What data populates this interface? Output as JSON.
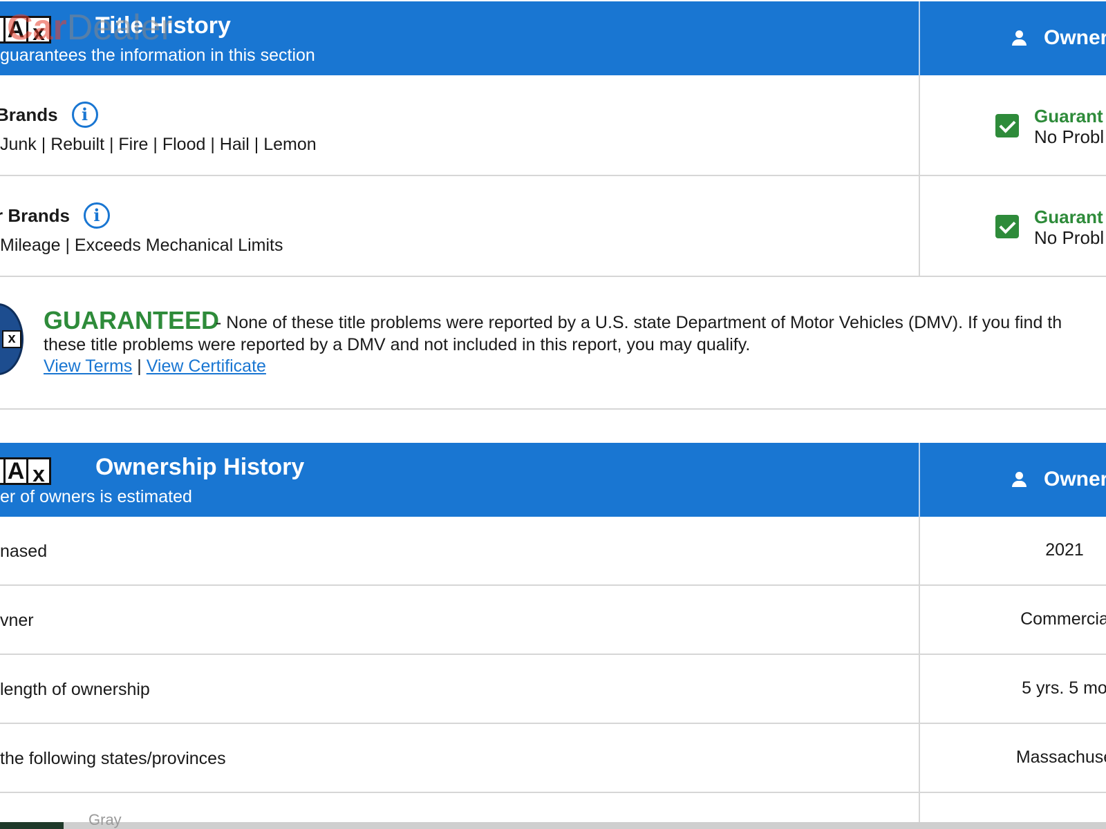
{
  "title_history": {
    "logo_letters": [
      "F",
      "A",
      "x"
    ],
    "title": "Title History",
    "subtitle": "guarantees the information in this section",
    "owner_col": "Owner"
  },
  "brand_rows": [
    {
      "title": "Brands",
      "list": "Junk | Rebuilt | Fire | Flood | Hail | Lemon",
      "status_label": "Guarant",
      "status_sub": "No Probl"
    },
    {
      "title": "r Brands",
      "list": " Mileage | Exceeds Mechanical Limits",
      "status_label": "Guarant",
      "status_sub": "No Probl"
    }
  ],
  "guarantee": {
    "heading": "GUARANTEED",
    "text_line1": "- None of these title problems were reported by a U.S. state Department of Motor Vehicles (DMV). If you find th",
    "text_line2": "these title problems were reported by a DMV and not included in this report, you may qualify.",
    "link_terms": "View Terms",
    "separator": "|",
    "link_certificate": "View Certificate",
    "seal_letters": "x"
  },
  "ownership_history": {
    "logo_letters": [
      "F",
      "A",
      "x"
    ],
    "title": "Ownership History",
    "subtitle": "er of owners is estimated",
    "owner_col": "Owner",
    "rows": [
      {
        "label": "nased",
        "value": "2021"
      },
      {
        "label": "vner",
        "value": "Commercia"
      },
      {
        "label": " length of ownership",
        "value": "5 yrs. 5 mo"
      },
      {
        "label": "the following states/provinces",
        "value": "Massachuse"
      }
    ]
  },
  "bottom": {
    "peek_text": "Gray"
  },
  "watermark": {
    "car": "Car",
    "dealer": "Dealer"
  },
  "colors": {
    "header_blue": "#1976d2",
    "guarantee_green": "#2e8b3a",
    "link_blue": "#1976d2"
  }
}
